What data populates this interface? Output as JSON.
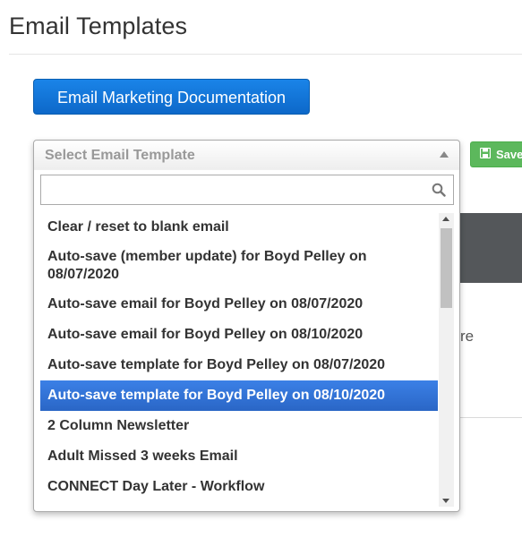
{
  "page": {
    "title": "Email Templates"
  },
  "toolbar": {
    "doc_button_label": "Email Marketing Documentation",
    "save_label": "Save"
  },
  "select": {
    "placeholder": "Select Email Template",
    "search_value": "",
    "options": [
      {
        "label": "Clear / reset to blank email",
        "highlighted": false
      },
      {
        "label": "Auto-save (member update) for Boyd Pelley on 08/07/2020",
        "highlighted": false
      },
      {
        "label": "Auto-save email for Boyd Pelley on 08/07/2020",
        "highlighted": false
      },
      {
        "label": "Auto-save email for Boyd Pelley on 08/10/2020",
        "highlighted": false
      },
      {
        "label": "Auto-save template for Boyd Pelley on 08/07/2020",
        "highlighted": false
      },
      {
        "label": "Auto-save template for Boyd Pelley on 08/10/2020",
        "highlighted": true
      },
      {
        "label": "2 Column Newsletter",
        "highlighted": false
      },
      {
        "label": "Adult Missed 3 weeks Email",
        "highlighted": false
      },
      {
        "label": "CONNECT Day Later - Workflow",
        "highlighted": false
      }
    ]
  },
  "background": {
    "partial_text": "re"
  },
  "colors": {
    "primary": "#1a84e8",
    "success": "#5cb85c",
    "highlight": "#3875d7"
  },
  "icons": {
    "save": "floppy-disk-icon",
    "search": "magnifier-icon",
    "dropdown": "caret-up-icon"
  }
}
